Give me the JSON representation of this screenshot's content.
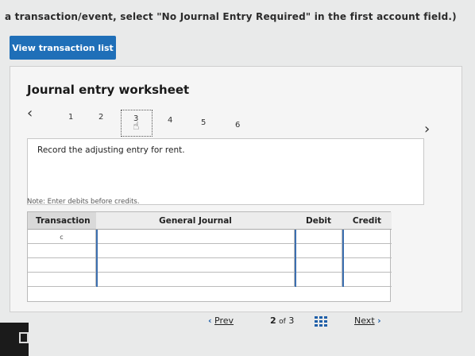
{
  "instruction": "a transaction/event, select \"No Journal Entry Required\" in the first account field.)",
  "view_button": "View transaction list",
  "worksheet": {
    "title": "Journal entry worksheet",
    "steps": [
      "1",
      "2",
      "3",
      "4",
      "5",
      "6"
    ],
    "active_step": "3",
    "description": "Record the adjusting entry for rent.",
    "note": "Note: Enter debits before credits."
  },
  "table": {
    "headers": {
      "transaction": "Transaction",
      "general_journal": "General Journal",
      "debit": "Debit",
      "credit": "Credit"
    },
    "rows": [
      {
        "transaction": "c"
      },
      {
        "transaction": ""
      },
      {
        "transaction": ""
      },
      {
        "transaction": ""
      }
    ]
  },
  "pager": {
    "prev": "Prev",
    "current": "2",
    "of": "of",
    "total": "3",
    "next": "Next"
  }
}
